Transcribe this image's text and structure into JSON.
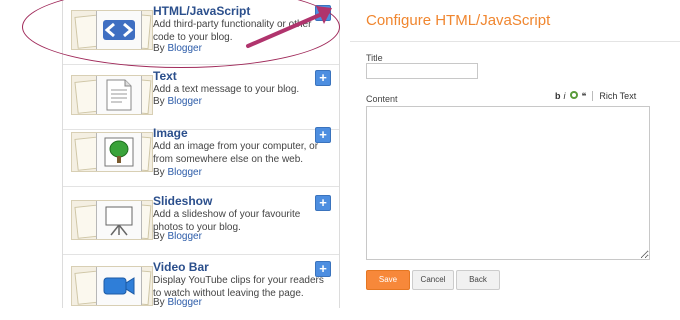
{
  "gadgets": [
    {
      "title": "HTML/JavaScript",
      "desc": "Add third-party functionality or other code to your blog.",
      "by_prefix": "By",
      "by_link": "Blogger",
      "icon": "code-brackets-icon"
    },
    {
      "title": "Text",
      "desc": "Add a text message to your blog.",
      "by_prefix": "By",
      "by_link": "Blogger",
      "icon": "text-document-icon"
    },
    {
      "title": "Image",
      "desc": "Add an image from your computer, or from somewhere else on the web.",
      "by_prefix": "By",
      "by_link": "Blogger",
      "icon": "tree-picture-icon"
    },
    {
      "title": "Slideshow",
      "desc": "Add a slideshow of your favourite photos to your blog.",
      "by_prefix": "By",
      "by_link": "Blogger",
      "icon": "projector-screen-icon"
    },
    {
      "title": "Video Bar",
      "desc": "Display YouTube clips for your readers to watch without leaving the page.",
      "by_prefix": "By",
      "by_link": "Blogger",
      "icon": "video-camera-icon"
    }
  ],
  "add_symbol": "+",
  "config": {
    "title": "Configure HTML/JavaScript",
    "title_label": "Title",
    "title_value": "",
    "content_label": "Content",
    "toolbar": {
      "bold": "b",
      "italic": "i",
      "quote": "❝",
      "rich_text": "Rich Text"
    },
    "buttons": {
      "save": "Save",
      "cancel": "Cancel",
      "back": "Back"
    }
  },
  "colors": {
    "accent": "#f0862f",
    "link": "#2b5ba8",
    "add_button": "#4d8ee0",
    "annotation": "#b0346d"
  }
}
